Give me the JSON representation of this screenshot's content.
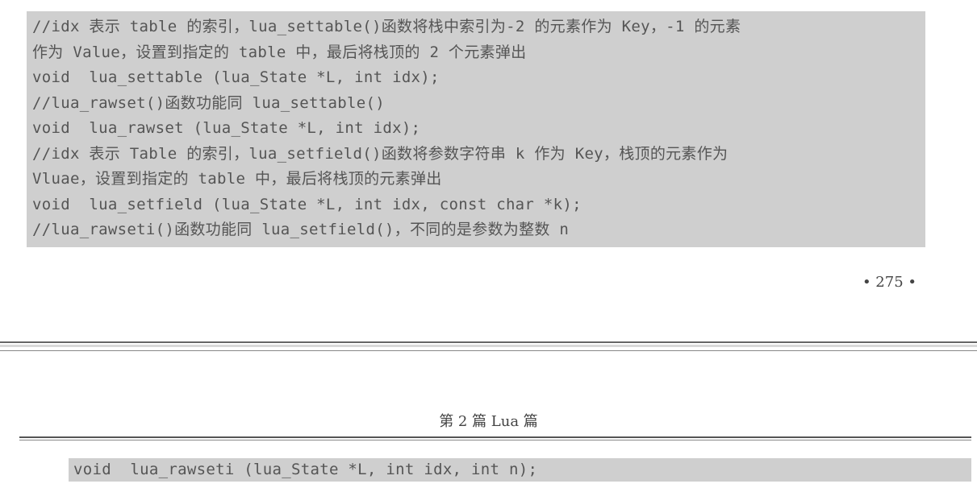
{
  "top_page": {
    "code_lines": [
      "//idx 表示 table 的索引，lua_settable()函数将栈中索引为-2 的元素作为 Key，-1 的元素",
      "作为 Value，设置到指定的 table 中，最后将栈顶的 2 个元素弹出",
      "void  lua_settable (lua_State *L, int idx);",
      "//lua_rawset()函数功能同 lua_settable()",
      "void  lua_rawset (lua_State *L, int idx);",
      "//idx 表示 Table 的索引，lua_setfield()函数将参数字符串 k 作为 Key，栈顶的元素作为",
      "Vluae，设置到指定的 table 中，最后将栈顶的元素弹出",
      "void  lua_setfield (lua_State *L, int idx, const char *k);",
      "//lua_rawseti()函数功能同 lua_setfield()，不同的是参数为整数 n"
    ],
    "page_number": "• 275 •"
  },
  "bottom_page": {
    "running_header": "第 2 篇   Lua 篇",
    "code_lines": [
      "void  lua_rawseti (lua_State *L, int idx, int n);"
    ]
  }
}
